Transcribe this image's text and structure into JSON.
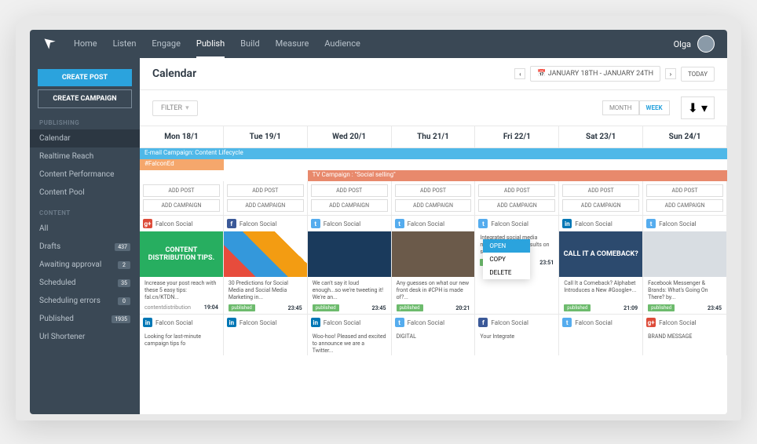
{
  "nav": [
    "Home",
    "Listen",
    "Engage",
    "Publish",
    "Build",
    "Measure",
    "Audience"
  ],
  "nav_active": 3,
  "user": "Olga",
  "sidebar": {
    "create_post": "CREATE POST",
    "create_campaign": "CREATE CAMPAIGN",
    "publishing_header": "PUBLISHING",
    "publishing": [
      "Calendar",
      "Realtime Reach",
      "Content Performance",
      "Content Pool"
    ],
    "content_header": "CONTENT",
    "content": [
      {
        "label": "All",
        "badge": null
      },
      {
        "label": "Drafts",
        "badge": "437"
      },
      {
        "label": "Awaiting approval",
        "badge": "2"
      },
      {
        "label": "Scheduled",
        "badge": "35"
      },
      {
        "label": "Scheduling errors",
        "badge": "0"
      },
      {
        "label": "Published",
        "badge": "1935"
      },
      {
        "label": "Url Shortener",
        "badge": null
      }
    ]
  },
  "page": {
    "title": "Calendar",
    "date_range": "JANUARY 18TH - JANUARY 24TH",
    "today": "TODAY",
    "filter": "FILTER",
    "views": [
      "MONTH",
      "WEEK"
    ],
    "view_active": 1
  },
  "days": [
    "Mon 18/1",
    "Tue 19/1",
    "Wed 20/1",
    "Thu 21/1",
    "Fri 22/1",
    "Sat 23/1",
    "Sun 24/1"
  ],
  "campaigns": {
    "c1": "E-mail Campaign: Content Lifecycle",
    "c2": "#FalconEd",
    "c3": "TV Campaign : \"Social selling\""
  },
  "add": {
    "post": "ADD POST",
    "campaign": "ADD CAMPAIGN"
  },
  "account": "Falcon Social",
  "posts": [
    {
      "net": "gp",
      "glyph": "g+",
      "img": "img-green",
      "img_text": "CONTENT DISTRIBUTION TIPS.",
      "text": "Increase your post reach with these 5 easy tips: fal.cn/KTDN...",
      "status": null,
      "hashtag": "contentdistribution",
      "time": "19:04"
    },
    {
      "net": "fb",
      "glyph": "f",
      "img": "img-collage",
      "img_text": "",
      "text": "30 Predictions for Social Media and Social Media Marketing in...",
      "status": "published",
      "hashtag": null,
      "time": "23:45"
    },
    {
      "net": "tw",
      "glyph": "t",
      "img": "img-navy",
      "img_text": "",
      "text": "We can't say it loud enough...so we're tweeting it! We're an...",
      "status": "published",
      "hashtag": null,
      "time": "23:45"
    },
    {
      "net": "tw",
      "glyph": "t",
      "img": "img-wood",
      "img_text": "",
      "text": "Any guesses on what our new front desk in #CPH is made of?...",
      "status": "published",
      "hashtag": null,
      "time": "20:21"
    },
    {
      "net": "tw",
      "glyph": "t",
      "img": null,
      "img_text": "",
      "text": "Integrated social media management. Get results on social with a...",
      "status": "published",
      "hashtag": null,
      "time": "23:51",
      "menu": true
    },
    {
      "net": "li",
      "glyph": "in",
      "img": "img-navy2",
      "img_text": "CALL IT A COMEBACK?",
      "text": "Call It a Comeback? Alphabet Introduces a New #Google+...",
      "status": "published",
      "hashtag": null,
      "time": "21:09"
    },
    {
      "net": "tw",
      "glyph": "t",
      "img": "img-phone",
      "img_text": "",
      "text": "Facebook Messenger & Brands: What's Going On There? by...",
      "status": "published",
      "hashtag": null,
      "time": "23:45"
    }
  ],
  "posts2": [
    {
      "net": "li",
      "glyph": "in",
      "text": "Looking for last-minute campaign tips fo"
    },
    {
      "net": "li",
      "glyph": "in",
      "text": ""
    },
    {
      "net": "li",
      "glyph": "in",
      "text": "Woo-hoo! Pleased and excited to announce we are a Twitter..."
    },
    {
      "net": "tw",
      "glyph": "t",
      "text": "DIGITAL"
    },
    {
      "net": "fb",
      "glyph": "f",
      "text": "Your Integrate"
    },
    {
      "net": "tw",
      "glyph": "t",
      "text": ""
    },
    {
      "net": "gp",
      "glyph": "g+",
      "text": "BRAND MESSAGE"
    }
  ],
  "menu": {
    "open": "OPEN",
    "copy": "COPY",
    "delete": "DELETE"
  }
}
